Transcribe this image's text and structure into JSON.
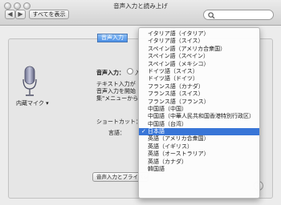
{
  "window": {
    "title": "音声入力と読み上げ"
  },
  "toolbar": {
    "back": "◀",
    "forward": "▶",
    "show_all": "すべてを表示",
    "search_placeholder": ""
  },
  "tabs": [
    {
      "label": "音声入力",
      "active": true
    }
  ],
  "mic": {
    "label": "内蔵マイク ▾"
  },
  "settings": {
    "voice_input_label": "音声入力：",
    "radio_option": "入",
    "description_line1": "テキスト入力が",
    "description_line2": "音声入力を開始",
    "description_line3": "集\"メニューから",
    "shortcut_label": "ショートカット：",
    "language_label": "言語："
  },
  "bottom_button": "音声入力とプライバシー",
  "help": "?",
  "language_menu": {
    "selected": "日本語",
    "items": [
      "イタリア語（イタリア）",
      "イタリア語（スイス）",
      "スペイン語（アメリカ合衆国）",
      "スペイン語（スペイン）",
      "スペイン語（メキシコ）",
      "ドイツ語（スイス）",
      "ドイツ語（ドイツ）",
      "フランス語（カナダ）",
      "フランス語（スイス）",
      "フランス語（フランス）",
      "中国語（中国）",
      "中国語（中華人民共和国香港特別行政区）",
      "中国語（台湾）",
      "日本語",
      "英語（アメリカ合衆国）",
      "英語（イギリス）",
      "英語（オーストラリア）",
      "英語（カナダ）",
      "韓国語"
    ]
  }
}
